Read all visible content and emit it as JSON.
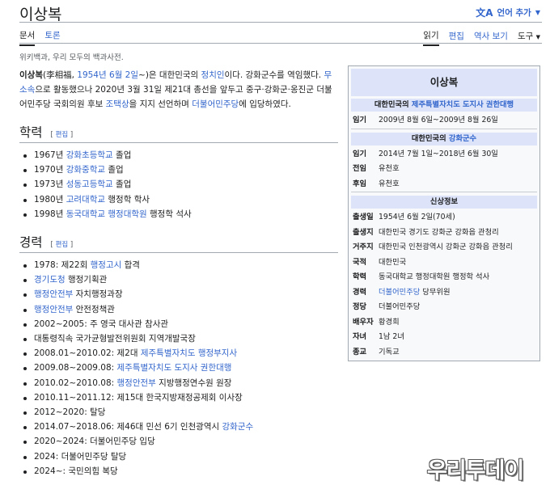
{
  "page": {
    "title": "이상복",
    "tagline": "위키백과, 우리 모두의 백과사전."
  },
  "lang_button": {
    "label": "언어 추가",
    "icon": "translate-icon"
  },
  "tabs_left": [
    {
      "label": "문서",
      "active": true
    },
    {
      "label": "토론",
      "active": false
    }
  ],
  "tabs_right": [
    "읽기",
    "편집",
    "역사 보기",
    "도구"
  ],
  "intro": {
    "name": "이상복",
    "hanja": "(李相福, ",
    "birth": "1954년 6월 2일",
    "p1": "~)은 대한민국의 ",
    "politician": "정치인",
    "p2": "이다. 강화군수를 역임했다. ",
    "independent": "무소속",
    "p3": "으로 활동했으나 2020년 3월 31일 제21대 총선을 앞두고 중구·강화군·옹진군 더불어민주당 국회의원 후보 ",
    "cho": "조택상",
    "p4": "을 지지 선언하며 ",
    "party": "더불어민주당",
    "p5": "에 입당하였다."
  },
  "sections": {
    "education": {
      "title": "학력",
      "edit": "편집",
      "items": [
        {
          "pre": "1967년 ",
          "link": "강화초등학교",
          "post": " 졸업"
        },
        {
          "pre": "1970년 ",
          "link": "강화중학교",
          "post": " 졸업"
        },
        {
          "pre": "1973년 ",
          "link": "성동고등학교",
          "post": " 졸업"
        },
        {
          "pre": "1980년 ",
          "link": "고려대학교",
          "post": " 행정학 학사"
        },
        {
          "pre": "1998년 ",
          "link": "동국대학교 행정대학원",
          "post": " 행정학 석사"
        }
      ]
    },
    "career": {
      "title": "경력",
      "edit": "편집",
      "items": [
        {
          "pre": "1978: 제22회 ",
          "link": "행정고시",
          "post": " 합격"
        },
        {
          "pre": "",
          "link": "경기도청",
          "post": " 행정기획관"
        },
        {
          "pre": "",
          "link": "행정안전부",
          "post": " 자치행정과장"
        },
        {
          "pre": "",
          "link": "행정안전부",
          "post": " 안전정책관"
        },
        {
          "pre": "2002~2005: 주 영국 대사관 참사관",
          "link": "",
          "post": ""
        },
        {
          "pre": "대통령직속 국가균형발전위원회 지역개발국장",
          "link": "",
          "post": ""
        },
        {
          "pre": "2008.01~2010.02: 제2대 ",
          "link": "제주특별자치도 행정부지사",
          "post": ""
        },
        {
          "pre": "2009.08~2009.08: ",
          "link": "제주특별자치도 도지사 권한대행",
          "post": ""
        },
        {
          "pre": "2010.02~2010.08: ",
          "link": "행정안전부",
          "post": " 지방행정연수원 원장"
        },
        {
          "pre": "2010.11~2011.12: 제15대 한국지방재정공제회 이사장",
          "link": "",
          "post": ""
        },
        {
          "pre": "2012~2020: 탈당",
          "link": "",
          "post": ""
        },
        {
          "pre": "2014.07~2018.06: 제46대 민선 6기 인천광역시 ",
          "link": "강화군수",
          "post": ""
        },
        {
          "pre": "2020~2024: 더불어민주당 입당",
          "link": "",
          "post": ""
        },
        {
          "pre": "2024: 더불어민주당 탈당",
          "link": "",
          "post": ""
        },
        {
          "pre": "2024~: 국민의힘 복당",
          "link": "",
          "post": ""
        }
      ]
    }
  },
  "infobox": {
    "title": "이상복",
    "block1": {
      "head_pre": "대한민국의 ",
      "head_link": "제주특별자치도 도지사 권한대행",
      "rows": [
        {
          "label": "임기",
          "value": "2009년 8월 6일~2009년 8월 26일"
        }
      ]
    },
    "block2": {
      "head_pre": "대한민국의 ",
      "head_link": "강화군수",
      "rows": [
        {
          "label": "임기",
          "value": "2014년 7월 1일~2018년 6월 30일",
          "link": false
        },
        {
          "label": "전임",
          "value": "유천호",
          "link": true
        },
        {
          "label": "후임",
          "value": "유천호",
          "link": true
        }
      ]
    },
    "block3": {
      "head": "신상정보",
      "rows": [
        {
          "label": "출생일",
          "value": "1954년 6월 2일(70세)",
          "link": false
        },
        {
          "label": "출생지",
          "value": "대한민국 경기도 강화군 강화읍 관청리",
          "link": false
        },
        {
          "label": "거주지",
          "value": "대한민국 인천광역시 강화군 강화읍 관청리",
          "link": false
        },
        {
          "label": "국적",
          "value": "대한민국",
          "link": false
        },
        {
          "label": "학력",
          "value": "동국대학교 행정대학원 행정학 석사",
          "link": true
        },
        {
          "label": "경력",
          "value": "더불어민주당 당무위원",
          "link": "partial"
        },
        {
          "label": "정당",
          "value": "더불어민주당",
          "link": true
        },
        {
          "label": "배우자",
          "value": "황경희",
          "link": false
        },
        {
          "label": "자녀",
          "value": "1남 2녀",
          "link": false
        },
        {
          "label": "종교",
          "value": "기독교",
          "link": true
        }
      ]
    }
  },
  "watermark": {
    "text": "우리투데이"
  },
  "colors": {
    "link": "#3366cc",
    "infobox_header": "#dde4fa",
    "text": "#202122"
  }
}
